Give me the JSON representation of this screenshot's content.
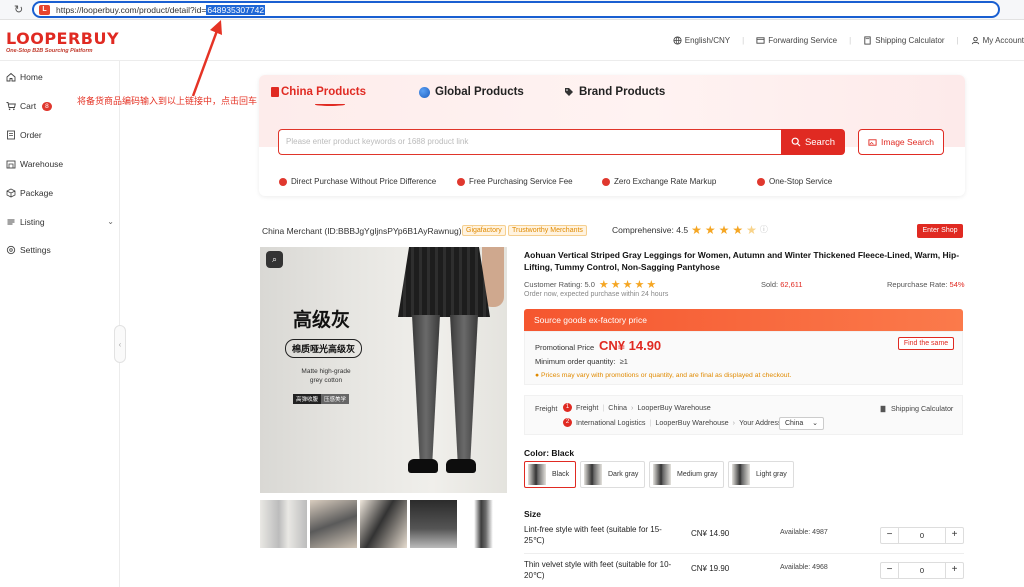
{
  "browser": {
    "url_prefix": "https://looperbuy.com/product/detail?id=",
    "url_id": "648935307742",
    "site_badge": "L"
  },
  "header": {
    "logo": "LOOPERBUY",
    "tagline": "One-Stop B2B Sourcing Platform",
    "links": [
      "English/CNY",
      "Forwarding Service",
      "Shipping Calculator",
      "My Account"
    ]
  },
  "sidebar": {
    "items": [
      {
        "label": "Home",
        "icon": "home-icon"
      },
      {
        "label": "Cart",
        "icon": "cart-icon",
        "badge": "8"
      },
      {
        "label": "Order",
        "icon": "order-icon"
      },
      {
        "label": "Warehouse",
        "icon": "warehouse-icon"
      },
      {
        "label": "Package",
        "icon": "package-icon"
      },
      {
        "label": "Listing",
        "icon": "listing-icon"
      },
      {
        "label": "Settings",
        "icon": "settings-icon"
      }
    ]
  },
  "annotation": "将备货商品编码输入到以上链接中，点击回车",
  "search": {
    "tabs": [
      "China Products",
      "Global Products",
      "Brand Products"
    ],
    "placeholder": "Please enter product keywords or 1688 product link",
    "search_label": "Search",
    "image_search_label": "Image Search",
    "features": [
      "Direct Purchase Without Price Difference",
      "Free Purchasing Service Fee",
      "Zero Exchange Rate Markup",
      "One-Stop Service"
    ]
  },
  "merchant": {
    "name": "China Merchant (ID:BBBJgYgljnsPYp6B1AyRawnug)",
    "tags": [
      "Gigafactory",
      "Trustworthy Merchants"
    ],
    "comprehensive_label": "Comprehensive: 4.5",
    "rating": 4.5,
    "enter_shop": "Enter Shop"
  },
  "image": {
    "title": "高级灰",
    "pill": "棉质哑光高级灰",
    "en_line1": "Matte high-grade",
    "en_line2": "grey cotton",
    "badge1": "高弹收腹",
    "badge2": "压感美学"
  },
  "product": {
    "title": "Aohuan Vertical Striped Gray Leggings for Women, Autumn and Winter Thickened Fleece-Lined, Warm, Hip-Lifting, Tummy Control, Non-Sagging Pantyhose",
    "customer_rating": "Customer Rating: 5.0",
    "customer_rating_value": 5.0,
    "sold_label": "Sold:",
    "sold_value": "62,611",
    "repurchase_label": "Repurchase Rate:",
    "repurchase_value": "54%",
    "order_note": "Order now, expected purchase within 24 hours",
    "price_header": "Source goods ex-factory price",
    "promo_label": "Promotional Price",
    "promo_price": "CN¥ 14.90",
    "find_same": "Find the same",
    "moq_label": "Minimum order quantity:",
    "moq_value": "≥1",
    "price_note": "Prices may vary with promotions or quantity, and are final as displayed at checkout.",
    "freight": {
      "label": "Freight",
      "step1": "Freight",
      "step1_from": "China",
      "step1_to": "LooperBuy Warehouse",
      "step2": "International Logistics",
      "step2_from": "LooperBuy Warehouse",
      "step2_to": "Your Address",
      "country": "China",
      "calculator": "Shipping Calculator"
    },
    "color_label": "Color: Black",
    "colors": [
      "Black",
      "Dark gray",
      "Medium gray",
      "Light gray"
    ],
    "size_label": "Size",
    "sizes": [
      {
        "name": "Lint-free style with feet (suitable for 15-25℃)",
        "price": "CN¥ 14.90",
        "available": "Available: 4987",
        "qty": "0"
      },
      {
        "name": "Thin velvet style with feet (suitable for 10-20℃)",
        "price": "CN¥ 19.90",
        "available": "Available: 4968",
        "qty": "0"
      }
    ]
  }
}
